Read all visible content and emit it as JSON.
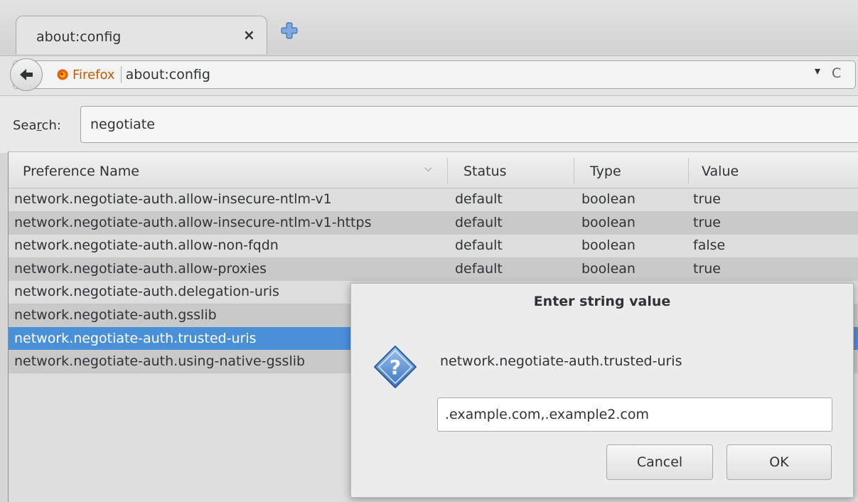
{
  "tab": {
    "title": "about:config",
    "close_glyph": "×"
  },
  "urlbar": {
    "identity": "Firefox",
    "url": "about:config",
    "dropdown_glyph": "▾",
    "reload_glyph": "C"
  },
  "search": {
    "label_pre": "Sea",
    "label_access": "r",
    "label_post": "ch:",
    "value": "negotiate"
  },
  "table": {
    "headers": [
      "Preference Name",
      "Status",
      "Type",
      "Value"
    ],
    "rows": [
      {
        "name": "network.negotiate-auth.allow-insecure-ntlm-v1",
        "status": "default",
        "type": "boolean",
        "value": "true"
      },
      {
        "name": "network.negotiate-auth.allow-insecure-ntlm-v1-https",
        "status": "default",
        "type": "boolean",
        "value": "true"
      },
      {
        "name": "network.negotiate-auth.allow-non-fqdn",
        "status": "default",
        "type": "boolean",
        "value": "false"
      },
      {
        "name": "network.negotiate-auth.allow-proxies",
        "status": "default",
        "type": "boolean",
        "value": "true"
      },
      {
        "name": "network.negotiate-auth.delegation-uris",
        "status": "",
        "type": "",
        "value": ""
      },
      {
        "name": "network.negotiate-auth.gsslib",
        "status": "",
        "type": "",
        "value": ""
      },
      {
        "name": "network.negotiate-auth.trusted-uris",
        "status": "",
        "type": "",
        "value": ""
      },
      {
        "name": "network.negotiate-auth.using-native-gsslib",
        "status": "",
        "type": "",
        "value": ""
      }
    ],
    "selected_index": 6
  },
  "dialog": {
    "title": "Enter string value",
    "message": "network.negotiate-auth.trusted-uris",
    "value": ".example.com,.example2.com",
    "cancel_label": "Cancel",
    "ok_label": "OK",
    "icon": "question-icon"
  },
  "colors": {
    "selection": "#4a90d9",
    "identity": "#c15b05"
  }
}
